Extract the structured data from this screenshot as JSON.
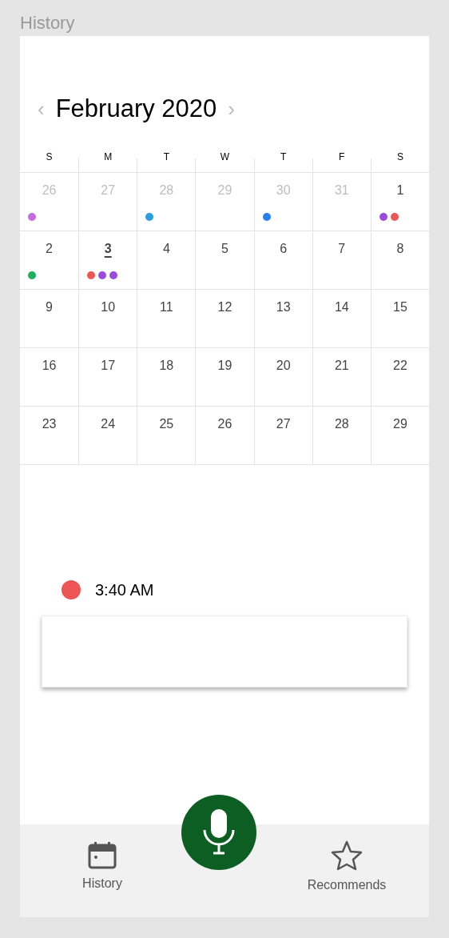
{
  "page_title": "History",
  "calendar": {
    "month": "February 2020",
    "prev": "‹",
    "next": "›",
    "weekdays": [
      "S",
      "M",
      "T",
      "W",
      "T",
      "F",
      "S"
    ],
    "weeks": [
      [
        {
          "day": "26",
          "outside": true,
          "today": false,
          "events": [
            {
              "color": "#c36be0"
            }
          ]
        },
        {
          "day": "27",
          "outside": true,
          "today": false
        },
        {
          "day": "28",
          "outside": true,
          "today": false,
          "events": [
            {
              "color": "#2a9de0"
            }
          ]
        },
        {
          "day": "29",
          "outside": true,
          "today": false
        },
        {
          "day": "30",
          "outside": true,
          "today": false,
          "events": [
            {
              "color": "#2a7fee"
            }
          ]
        },
        {
          "day": "31",
          "outside": true,
          "today": false
        },
        {
          "day": "1",
          "outside": false,
          "today": false,
          "events": [
            {
              "color": "#9b4be0"
            },
            {
              "color": "#ee5555"
            }
          ]
        }
      ],
      [
        {
          "day": "2",
          "outside": false,
          "today": false,
          "events": [
            {
              "color": "#1db05e"
            }
          ]
        },
        {
          "day": "3",
          "outside": false,
          "today": true,
          "events": [
            {
              "color": "#ee5555"
            },
            {
              "color": "#9b4be0"
            },
            {
              "color": "#9b4be0"
            }
          ]
        },
        {
          "day": "4",
          "outside": false,
          "today": false
        },
        {
          "day": "5",
          "outside": false,
          "today": false
        },
        {
          "day": "6",
          "outside": false,
          "today": false
        },
        {
          "day": "7",
          "outside": false,
          "today": false
        },
        {
          "day": "8",
          "outside": false,
          "today": false
        }
      ],
      [
        {
          "day": "9",
          "outside": false,
          "today": false
        },
        {
          "day": "10",
          "outside": false,
          "today": false
        },
        {
          "day": "11",
          "outside": false,
          "today": false
        },
        {
          "day": "12",
          "outside": false,
          "today": false
        },
        {
          "day": "13",
          "outside": false,
          "today": false
        },
        {
          "day": "14",
          "outside": false,
          "today": false
        },
        {
          "day": "15",
          "outside": false,
          "today": false
        }
      ],
      [
        {
          "day": "16",
          "outside": false,
          "today": false
        },
        {
          "day": "17",
          "outside": false,
          "today": false
        },
        {
          "day": "18",
          "outside": false,
          "today": false
        },
        {
          "day": "19",
          "outside": false,
          "today": false
        },
        {
          "day": "20",
          "outside": false,
          "today": false
        },
        {
          "day": "21",
          "outside": false,
          "today": false
        },
        {
          "day": "22",
          "outside": false,
          "today": false
        }
      ],
      [
        {
          "day": "23",
          "outside": false,
          "today": false
        },
        {
          "day": "24",
          "outside": false,
          "today": false
        },
        {
          "day": "25",
          "outside": false,
          "today": false
        },
        {
          "day": "26",
          "outside": false,
          "today": false
        },
        {
          "day": "27",
          "outside": false,
          "today": false
        },
        {
          "day": "28",
          "outside": false,
          "today": false
        },
        {
          "day": "29",
          "outside": false,
          "today": false
        }
      ]
    ]
  },
  "event": {
    "color": "#ee5555",
    "time": "3:40 AM"
  },
  "nav": [
    {
      "kind": "calendar",
      "label": "History"
    },
    {
      "kind": "star",
      "label": "Recommends"
    }
  ]
}
